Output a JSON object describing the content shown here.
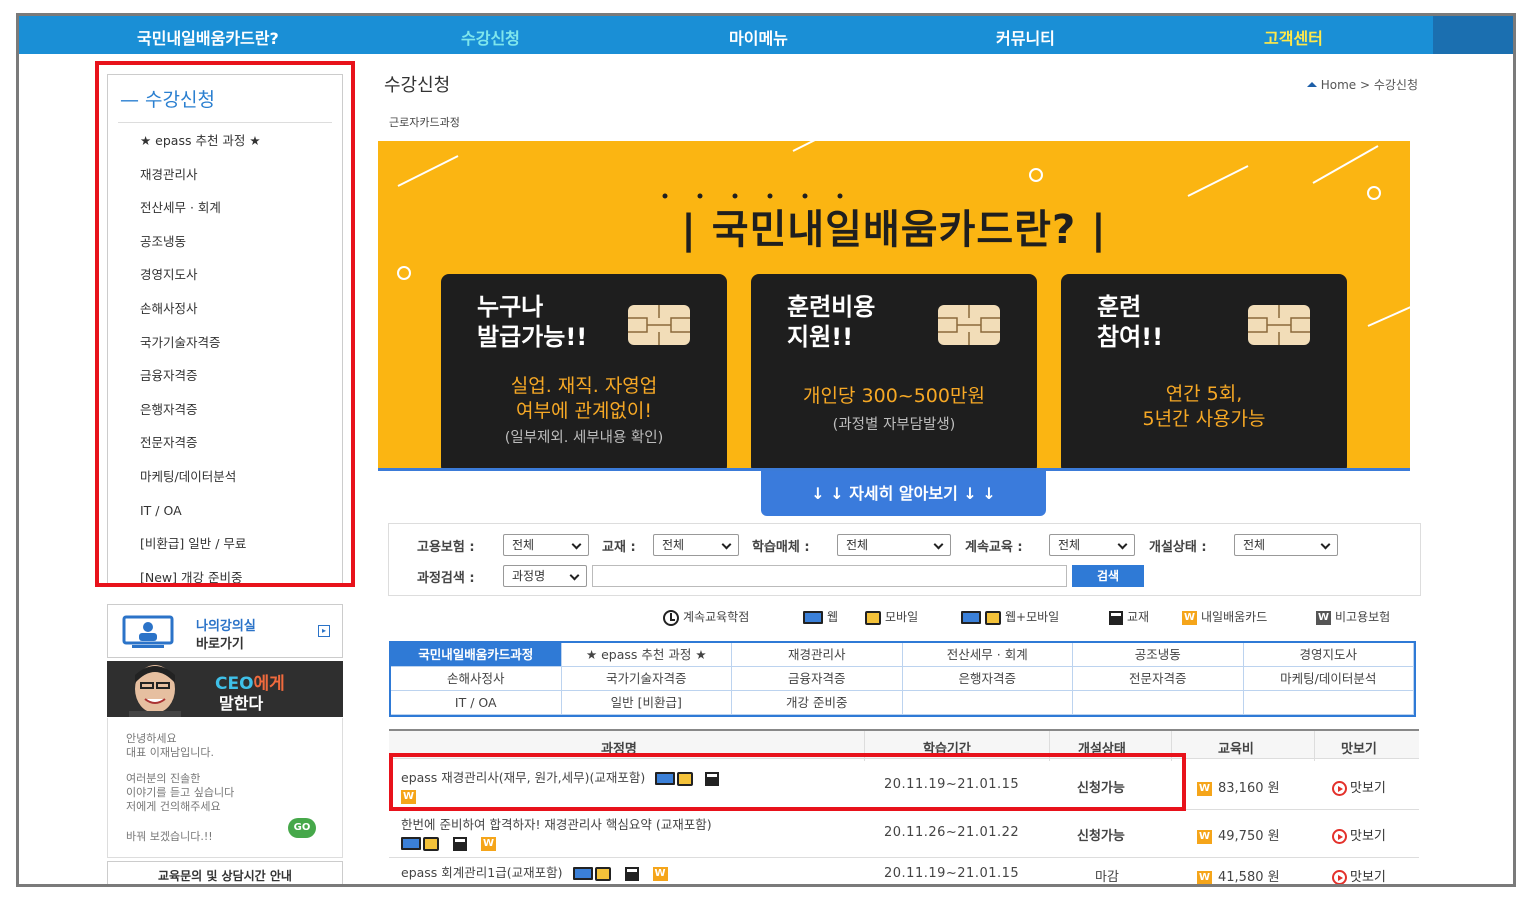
{
  "nav": {
    "items": [
      {
        "label": "국민내일배움카드란?",
        "color": "white"
      },
      {
        "label": "수강신청",
        "color": "teal"
      },
      {
        "label": "마이메뉴",
        "color": "white"
      },
      {
        "label": "커뮤니티",
        "color": "white"
      },
      {
        "label": "고객센터",
        "color": "yellow"
      }
    ],
    "bg_color": "#1a8fd6"
  },
  "sidebar": {
    "title": "수강신청",
    "items": [
      "★ epass 추천 과정 ★",
      "재경관리사",
      "전산세무 · 회계",
      "공조냉동",
      "경영지도사",
      "손해사정사",
      "국가기술자격증",
      "금융자격증",
      "은행자격증",
      "전문자격증",
      "마케팅/데이터분석",
      "IT / OA",
      "[비환급] 일반 / 무료",
      "[New] 개강 준비중"
    ],
    "lecture_room": {
      "line1": "나의강의실",
      "line2": "바로가기"
    },
    "ceo": {
      "title_a": "CEO",
      "title_b": "에게",
      "title_c": "말한다"
    },
    "ceo_text": {
      "p1": "안녕하세요\n대표 이재남입니다.",
      "p2": "여러분의 진솔한\n이야기를 듣고 싶습니다\n저에게 건의해주세요",
      "p3": "바꿔 보겠습니다.!!",
      "go": "GO"
    },
    "consult": "교육문의 및 상담시간 안내"
  },
  "main": {
    "title": "수강신청",
    "breadcrumb": "Home > 수강신청",
    "sub_label": "근로자카드과정"
  },
  "banner": {
    "title": "| 국민내일배움카드란? |",
    "cards": [
      {
        "heading": "누구나\n발급가능!!",
        "desc": "실업. 재직. 자영업\n여부에 관계없이!",
        "note": "(일부제외. 세부내용 확인)"
      },
      {
        "heading": "훈련비용\n지원!!",
        "desc": "개인당 300~500만원",
        "note": "(과정별 자부담발생)"
      },
      {
        "heading": "훈련\n참여!!",
        "desc": "연간 5회,\n5년간 사용가능",
        "note": ""
      }
    ],
    "more_button": "↓ ↓ 자세히 알아보기 ↓ ↓",
    "bg_color": "#fbb512"
  },
  "filters": {
    "employment_label": "고용보험 :",
    "employment_value": "전체",
    "textbook_label": "교재 :",
    "textbook_value": "전체",
    "media_label": "학습매체 :",
    "media_value": "전체",
    "continuing_label": "계속교육 :",
    "continuing_value": "전체",
    "status_label": "개설상태 :",
    "status_value": "전체",
    "search_label": "과정검색 :",
    "search_type": "과정명",
    "search_input": "",
    "search_button": "검색"
  },
  "legend": {
    "continuing": "계속교육학점",
    "web": "웹",
    "mobile": "모바일",
    "web_mobile": "웹+모바일",
    "book": "교재",
    "card": "내일배움카드",
    "non_insured": "비고용보험"
  },
  "categories": [
    "국민내일배움카드과정",
    "★ epass 추천 과정 ★",
    "재경관리사",
    "전산세무 · 회계",
    "공조냉동",
    "경영지도사",
    "손해사정사",
    "국가기술자격증",
    "금융자격증",
    "은행자격증",
    "전문자격증",
    "마케팅/데이터분석",
    "IT / OA",
    "일반 [비환급]",
    "개강 준비중",
    "",
    "",
    ""
  ],
  "table": {
    "headers": {
      "name": "과정명",
      "period": "학습기간",
      "status": "개설상태",
      "fee": "교육비",
      "preview": "맛보기"
    },
    "rows": [
      {
        "name": "epass 재경관리사(재무, 원가,세무)(교재포함)",
        "period": "20.11.19~21.01.15",
        "status": "신청가능",
        "fee": "83,160 원",
        "preview": "맛보기"
      },
      {
        "name": "한번에 준비하여 합격하자! 재경관리사 핵심요약 (교재포함)",
        "period": "20.11.26~21.01.22",
        "status": "신청가능",
        "fee": "49,750 원",
        "preview": "맛보기"
      },
      {
        "name": "epass 회계관리1급(교재포함)",
        "period": "20.11.19~21.01.15",
        "status": "마감",
        "fee": "41,580 원",
        "preview": "맛보기"
      }
    ]
  },
  "icon_w": "W"
}
